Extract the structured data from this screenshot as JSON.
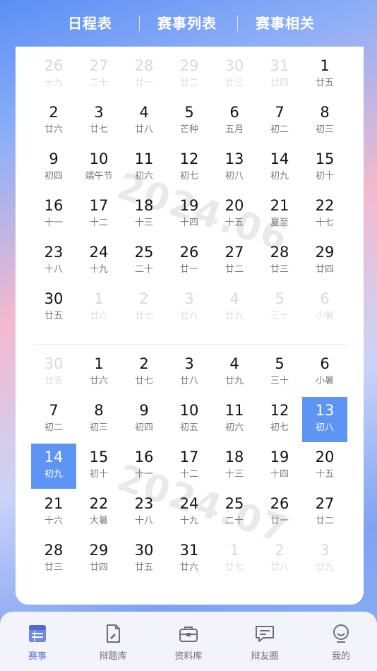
{
  "tabs": {
    "schedule": "日程表",
    "match_list": "赛事列表",
    "related": "赛事相关"
  },
  "june": {
    "watermark": "2024.06",
    "cells": [
      {
        "d": "26",
        "l": "十九",
        "m": true
      },
      {
        "d": "27",
        "l": "二十",
        "m": true
      },
      {
        "d": "28",
        "l": "廿一",
        "m": true
      },
      {
        "d": "29",
        "l": "廿二",
        "m": true
      },
      {
        "d": "30",
        "l": "廿三",
        "m": true
      },
      {
        "d": "31",
        "l": "廿四",
        "m": true
      },
      {
        "d": "1",
        "l": "廿五",
        "m": false
      },
      {
        "d": "2",
        "l": "廿六",
        "m": false
      },
      {
        "d": "3",
        "l": "廿七",
        "m": false
      },
      {
        "d": "4",
        "l": "廿八",
        "m": false
      },
      {
        "d": "5",
        "l": "芒种",
        "m": false
      },
      {
        "d": "6",
        "l": "五月",
        "m": false
      },
      {
        "d": "7",
        "l": "初二",
        "m": false
      },
      {
        "d": "8",
        "l": "初三",
        "m": false
      },
      {
        "d": "9",
        "l": "初四",
        "m": false
      },
      {
        "d": "10",
        "l": "端午节",
        "m": false
      },
      {
        "d": "11",
        "l": "初六",
        "m": false
      },
      {
        "d": "12",
        "l": "初七",
        "m": false
      },
      {
        "d": "13",
        "l": "初八",
        "m": false
      },
      {
        "d": "14",
        "l": "初九",
        "m": false
      },
      {
        "d": "15",
        "l": "初十",
        "m": false
      },
      {
        "d": "16",
        "l": "十一",
        "m": false
      },
      {
        "d": "17",
        "l": "十二",
        "m": false
      },
      {
        "d": "18",
        "l": "十三",
        "m": false
      },
      {
        "d": "19",
        "l": "十四",
        "m": false
      },
      {
        "d": "20",
        "l": "十五",
        "m": false
      },
      {
        "d": "21",
        "l": "夏至",
        "m": false
      },
      {
        "d": "22",
        "l": "十七",
        "m": false
      },
      {
        "d": "23",
        "l": "十八",
        "m": false
      },
      {
        "d": "24",
        "l": "十九",
        "m": false
      },
      {
        "d": "25",
        "l": "二十",
        "m": false
      },
      {
        "d": "26",
        "l": "廿一",
        "m": false
      },
      {
        "d": "27",
        "l": "廿二",
        "m": false
      },
      {
        "d": "28",
        "l": "廿三",
        "m": false
      },
      {
        "d": "29",
        "l": "廿四",
        "m": false
      },
      {
        "d": "30",
        "l": "廿五",
        "m": false
      },
      {
        "d": "1",
        "l": "廿六",
        "m": true
      },
      {
        "d": "2",
        "l": "廿七",
        "m": true
      },
      {
        "d": "3",
        "l": "廿八",
        "m": true
      },
      {
        "d": "4",
        "l": "廿九",
        "m": true
      },
      {
        "d": "5",
        "l": "三十",
        "m": true
      },
      {
        "d": "6",
        "l": "小暑",
        "m": true
      }
    ]
  },
  "july": {
    "watermark": "2024.07",
    "cells": [
      {
        "d": "30",
        "l": "廿五",
        "m": true
      },
      {
        "d": "1",
        "l": "廿六",
        "m": false
      },
      {
        "d": "2",
        "l": "廿七",
        "m": false
      },
      {
        "d": "3",
        "l": "廿八",
        "m": false
      },
      {
        "d": "4",
        "l": "廿九",
        "m": false
      },
      {
        "d": "5",
        "l": "三十",
        "m": false
      },
      {
        "d": "6",
        "l": "小暑",
        "m": false
      },
      {
        "d": "7",
        "l": "初二",
        "m": false
      },
      {
        "d": "8",
        "l": "初三",
        "m": false
      },
      {
        "d": "9",
        "l": "初四",
        "m": false
      },
      {
        "d": "10",
        "l": "初五",
        "m": false
      },
      {
        "d": "11",
        "l": "初六",
        "m": false
      },
      {
        "d": "12",
        "l": "初七",
        "m": false
      },
      {
        "d": "13",
        "l": "初八",
        "m": false,
        "sel": true
      },
      {
        "d": "14",
        "l": "初九",
        "m": false,
        "sel": true
      },
      {
        "d": "15",
        "l": "初十",
        "m": false
      },
      {
        "d": "16",
        "l": "十一",
        "m": false
      },
      {
        "d": "17",
        "l": "十二",
        "m": false
      },
      {
        "d": "18",
        "l": "十三",
        "m": false
      },
      {
        "d": "19",
        "l": "十四",
        "m": false
      },
      {
        "d": "20",
        "l": "十五",
        "m": false
      },
      {
        "d": "21",
        "l": "十六",
        "m": false
      },
      {
        "d": "22",
        "l": "大暑",
        "m": false
      },
      {
        "d": "23",
        "l": "十八",
        "m": false
      },
      {
        "d": "24",
        "l": "十九",
        "m": false
      },
      {
        "d": "25",
        "l": "二十",
        "m": false
      },
      {
        "d": "26",
        "l": "廿一",
        "m": false
      },
      {
        "d": "27",
        "l": "廿二",
        "m": false
      },
      {
        "d": "28",
        "l": "廿三",
        "m": false
      },
      {
        "d": "29",
        "l": "廿四",
        "m": false
      },
      {
        "d": "30",
        "l": "廿五",
        "m": false
      },
      {
        "d": "31",
        "l": "廿六",
        "m": false
      },
      {
        "d": "1",
        "l": "廿七",
        "m": true
      },
      {
        "d": "2",
        "l": "廿八",
        "m": true
      },
      {
        "d": "3",
        "l": "廿九",
        "m": true
      }
    ]
  },
  "nav": [
    {
      "label": "赛事",
      "icon": "calendar-list-icon",
      "active": true
    },
    {
      "label": "辩题库",
      "icon": "document-icon",
      "active": false
    },
    {
      "label": "资料库",
      "icon": "briefcase-icon",
      "active": false
    },
    {
      "label": "辩友圈",
      "icon": "chat-bubble-icon",
      "active": false
    },
    {
      "label": "我的",
      "icon": "profile-icon",
      "active": false
    }
  ],
  "colors": {
    "accent": "#5e95f4",
    "nav_active": "#5b73d9"
  }
}
